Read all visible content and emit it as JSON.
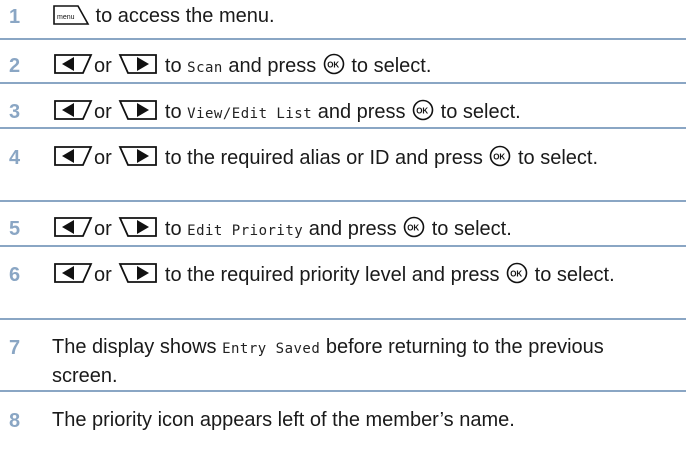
{
  "steps": [
    {
      "num": "1",
      "parts": [
        {
          "icon": "menu-key-icon"
        },
        {
          "text": " to access the menu."
        }
      ]
    },
    {
      "num": "2",
      "parts": [
        {
          "icon": "left-arrow-key-icon"
        },
        {
          "text": "or "
        },
        {
          "icon": "right-arrow-key-icon"
        },
        {
          "text": " to "
        },
        {
          "mono": "Scan"
        },
        {
          "text": " and press "
        },
        {
          "icon": "ok-key-icon"
        },
        {
          "text": " to select."
        }
      ]
    },
    {
      "num": "3",
      "parts": [
        {
          "icon": "left-arrow-key-icon"
        },
        {
          "text": "or "
        },
        {
          "icon": "right-arrow-key-icon"
        },
        {
          "text": " to "
        },
        {
          "mono": "View/Edit List"
        },
        {
          "text": " and press "
        },
        {
          "icon": "ok-key-icon"
        },
        {
          "text": " to select."
        }
      ]
    },
    {
      "num": "4",
      "parts": [
        {
          "icon": "left-arrow-key-icon"
        },
        {
          "text": "or "
        },
        {
          "icon": "right-arrow-key-icon"
        },
        {
          "text": " to the required alias or ID and press "
        },
        {
          "icon": "ok-key-icon"
        },
        {
          "text": " to select."
        }
      ]
    },
    {
      "num": "5",
      "parts": [
        {
          "icon": "left-arrow-key-icon"
        },
        {
          "text": "or "
        },
        {
          "icon": "right-arrow-key-icon"
        },
        {
          "text": " to "
        },
        {
          "mono": "Edit Priority"
        },
        {
          "text": " and press "
        },
        {
          "icon": "ok-key-icon"
        },
        {
          "text": " to select."
        }
      ]
    },
    {
      "num": "6",
      "parts": [
        {
          "icon": "left-arrow-key-icon"
        },
        {
          "text": "or "
        },
        {
          "icon": "right-arrow-key-icon"
        },
        {
          "text": " to the required priority level and press "
        },
        {
          "icon": "ok-key-icon"
        },
        {
          "text": " to select."
        }
      ]
    },
    {
      "num": "7",
      "parts": [
        {
          "text": "The display shows "
        },
        {
          "mono": "Entry Saved"
        },
        {
          "text": " before returning to the previous screen."
        }
      ]
    },
    {
      "num": "8",
      "parts": [
        {
          "text": "The priority icon appears left of the member’s name."
        }
      ]
    }
  ],
  "icons": {
    "menu_key_label": "menu"
  },
  "colors": {
    "accent": "#8aa6c4",
    "text": "#1a1a1a"
  }
}
